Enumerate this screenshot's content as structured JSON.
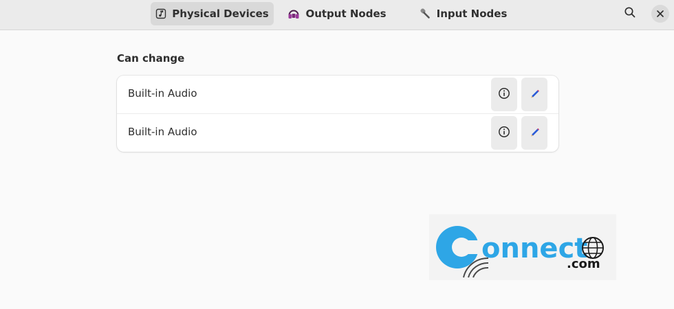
{
  "header": {
    "tabs": [
      {
        "label": "Physical Devices",
        "icon": "music-note-icon",
        "active": true
      },
      {
        "label": "Output Nodes",
        "icon": "headphones-icon",
        "active": false
      },
      {
        "label": "Input Nodes",
        "icon": "microphone-icon",
        "active": false
      }
    ],
    "search_icon": "search-icon",
    "close_icon": "close-icon"
  },
  "section": {
    "title": "Can change",
    "devices": [
      {
        "label": "Built-in Audio",
        "info_icon": "info-icon",
        "edit_icon": "pencil-icon"
      },
      {
        "label": "Built-in Audio",
        "info_icon": "info-icon",
        "edit_icon": "pencil-icon"
      }
    ]
  },
  "watermark": {
    "text": "onnect",
    "suffix": ".com"
  },
  "colors": {
    "headerbar_bg": "#ebebeb",
    "active_tab_bg": "#d9d9d9",
    "window_bg": "#fafafa",
    "card_bg": "#ffffff",
    "button_bg": "#ebebeb",
    "headphones_accent": "#8b2e8b",
    "pencil_blue": "#2a5bd7",
    "watermark_blue": "#2ea6e6"
  }
}
